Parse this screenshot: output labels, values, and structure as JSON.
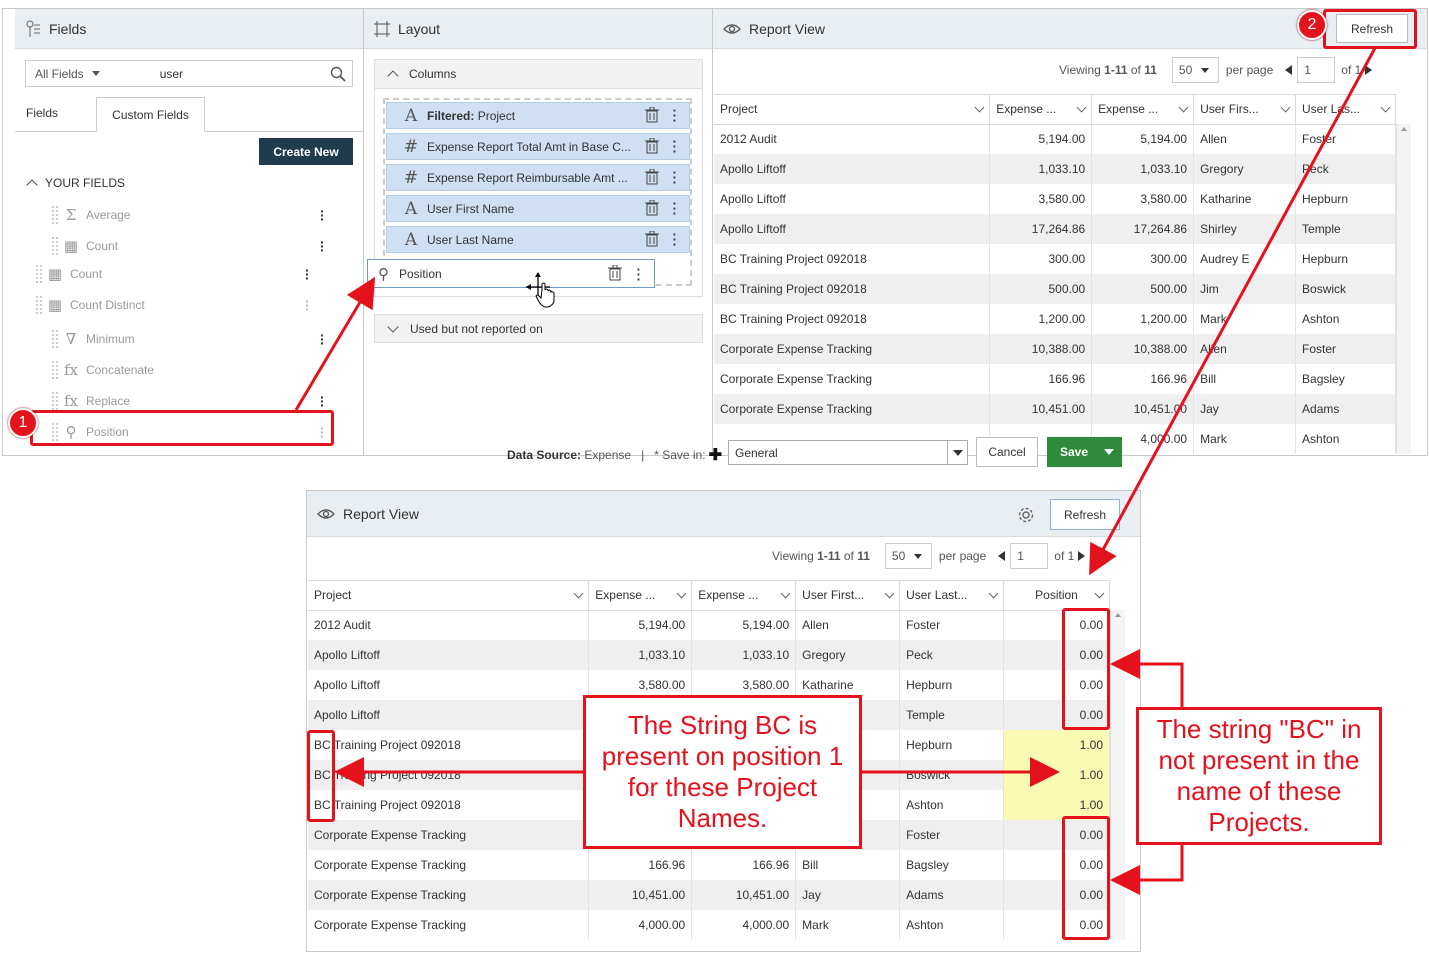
{
  "fields_panel": {
    "title": "Fields",
    "filter_select": "All Fields",
    "search_value": "user",
    "tabs": [
      "Fields",
      "Custom Fields"
    ],
    "create_button": "Create New",
    "section_title": "YOUR FIELDS",
    "items": [
      "Average",
      "Count",
      "Count",
      "Count Distinct",
      "Minimum",
      "Concatenate",
      "Replace",
      "Position"
    ]
  },
  "layout_panel": {
    "title": "Layout",
    "columns_label": "Columns",
    "columns": [
      {
        "prefix": "Filtered:",
        "label": "Project",
        "icon": "text-icon"
      },
      {
        "prefix": "",
        "label": "Expense Report Total Amt in Base C...",
        "icon": "hash-icon"
      },
      {
        "prefix": "",
        "label": "Expense Report Reimbursable Amt ...",
        "icon": "hash-icon"
      },
      {
        "prefix": "",
        "label": "User First Name",
        "icon": "text-icon"
      },
      {
        "prefix": "",
        "label": "User Last Name",
        "icon": "text-icon"
      }
    ],
    "dragging_item": "Position",
    "unused_label": "Used but not reported on"
  },
  "report_top": {
    "title": "Report View",
    "refresh": "Refresh",
    "viewing": "Viewing",
    "range": "1-11",
    "of_word": "of",
    "total": "11",
    "per_page_value": "50",
    "per_page_label": "per page",
    "page_value": "1",
    "of_pages": "of 1",
    "headers": [
      "Project",
      "Expense ...",
      "Expense ...",
      "User Firs...",
      "User Las..."
    ],
    "rows": [
      [
        "2012 Audit",
        "5,194.00",
        "5,194.00",
        "Allen",
        "Foster"
      ],
      [
        "Apollo Liftoff",
        "1,033.10",
        "1,033.10",
        "Gregory",
        "Peck"
      ],
      [
        "Apollo Liftoff",
        "3,580.00",
        "3,580.00",
        "Katharine",
        "Hepburn"
      ],
      [
        "Apollo Liftoff",
        "17,264.86",
        "17,264.86",
        "Shirley",
        "Temple"
      ],
      [
        "BC Training Project 092018",
        "300.00",
        "300.00",
        "Audrey E",
        "Hepburn"
      ],
      [
        "BC Training Project 092018",
        "500.00",
        "500.00",
        "Jim",
        "Boswick"
      ],
      [
        "BC Training Project 092018",
        "1,200.00",
        "1,200.00",
        "Mark",
        "Ashton"
      ],
      [
        "Corporate Expense Tracking",
        "10,388.00",
        "10,388.00",
        "Allen",
        "Foster"
      ],
      [
        "Corporate Expense Tracking",
        "166.96",
        "166.96",
        "Bill",
        "Bagsley"
      ],
      [
        "Corporate Expense Tracking",
        "10,451.00",
        "10,451.00",
        "Jay",
        "Adams"
      ],
      [
        "",
        "",
        "4,000.00",
        "Mark",
        "Ashton"
      ]
    ]
  },
  "footer": {
    "data_source_label": "Data Source:",
    "data_source_value": "Expense",
    "separator": "|",
    "save_in_label": "* Save in:",
    "save_in_value": "General",
    "cancel": "Cancel",
    "save": "Save"
  },
  "report_bottom": {
    "title": "Report View",
    "refresh": "Refresh",
    "viewing": "Viewing",
    "range": "1-11",
    "of_word": "of",
    "total": "11",
    "per_page_value": "50",
    "per_page_label": "per page",
    "page_value": "1",
    "of_pages": "of 1",
    "headers": [
      "Project",
      "Expense ...",
      "Expense ...",
      "User First...",
      "User Last...",
      "Position"
    ],
    "rows": [
      [
        "2012 Audit",
        "5,194.00",
        "5,194.00",
        "Allen",
        "Foster",
        "0.00"
      ],
      [
        "Apollo Liftoff",
        "1,033.10",
        "1,033.10",
        "Gregory",
        "Peck",
        "0.00"
      ],
      [
        "Apollo Liftoff",
        "3,580.00",
        "3,580.00",
        "Katharine",
        "Hepburn",
        "0.00"
      ],
      [
        "Apollo Liftoff",
        "",
        "",
        "",
        "Temple",
        "0.00"
      ],
      [
        "BC Training Project 092018",
        "",
        "",
        "",
        "Hepburn",
        "1.00"
      ],
      [
        "BC Training Project 092018",
        "",
        "",
        "",
        "Boswick",
        "1.00"
      ],
      [
        "BC Training Project 092018",
        "",
        "",
        "",
        "Ashton",
        "1.00"
      ],
      [
        "Corporate Expense Tracking",
        "",
        "",
        "",
        "Foster",
        "0.00"
      ],
      [
        "Corporate Expense Tracking",
        "166.96",
        "166.96",
        "Bill",
        "Bagsley",
        "0.00"
      ],
      [
        "Corporate Expense Tracking",
        "10,451.00",
        "10,451.00",
        "Jay",
        "Adams",
        "0.00"
      ],
      [
        "Corporate Expense Tracking",
        "4,000.00",
        "4,000.00",
        "Mark",
        "Ashton",
        "0.00"
      ]
    ]
  },
  "annotations": {
    "badge1": "1",
    "badge2": "2",
    "callout_left": "The String BC is present on position 1 for these Project Names.",
    "callout_right": "The string \"BC\" in not present in the name of these Projects.",
    "accent_color": "#e4121c"
  }
}
